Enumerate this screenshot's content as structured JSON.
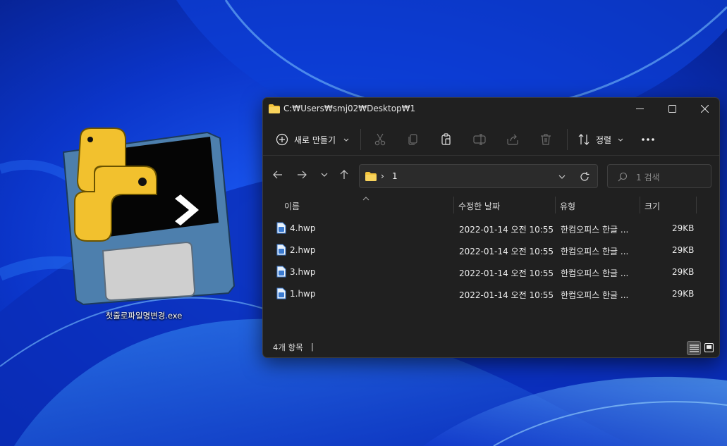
{
  "desktop": {
    "icon_label": "첫줄로파일명변경.exe",
    "icon_name": "python-floppy-icon"
  },
  "window": {
    "title": "C:₩Users₩smj02₩Desktop₩1",
    "controls": {
      "minimize": "minimize",
      "maximize": "maximize",
      "close": "close"
    }
  },
  "toolbar": {
    "new_label": "새로 만들기",
    "sort_label": "정렬",
    "icons": [
      "plus-circle-icon",
      "cut-icon",
      "copy-icon",
      "paste-icon",
      "rename-icon",
      "share-icon",
      "delete-icon",
      "sort-icon",
      "more-icon"
    ]
  },
  "nav": {
    "address_current": "1",
    "address_separator": "›",
    "search_placeholder": "1 검색"
  },
  "columns": {
    "name": "이름",
    "date": "수정한 날짜",
    "type": "유형",
    "size": "크기"
  },
  "files": [
    {
      "name": "4.hwp",
      "date": "2022-01-14 오전 10:55",
      "type": "한컴오피스 한글 ...",
      "size": "29KB"
    },
    {
      "name": "2.hwp",
      "date": "2022-01-14 오전 10:55",
      "type": "한컴오피스 한글 ...",
      "size": "29KB"
    },
    {
      "name": "3.hwp",
      "date": "2022-01-14 오전 10:55",
      "type": "한컴오피스 한글 ...",
      "size": "29KB"
    },
    {
      "name": "1.hwp",
      "date": "2022-01-14 오전 10:55",
      "type": "한컴오피스 한글 ...",
      "size": "29KB"
    }
  ],
  "status": {
    "item_count": "4개 항목",
    "caret": "|"
  },
  "colors": {
    "window_bg": "#202020",
    "folder_yellow": "#f3c33c",
    "python_yellow": "#f2c12e",
    "disk_blue": "#4d7fad"
  }
}
